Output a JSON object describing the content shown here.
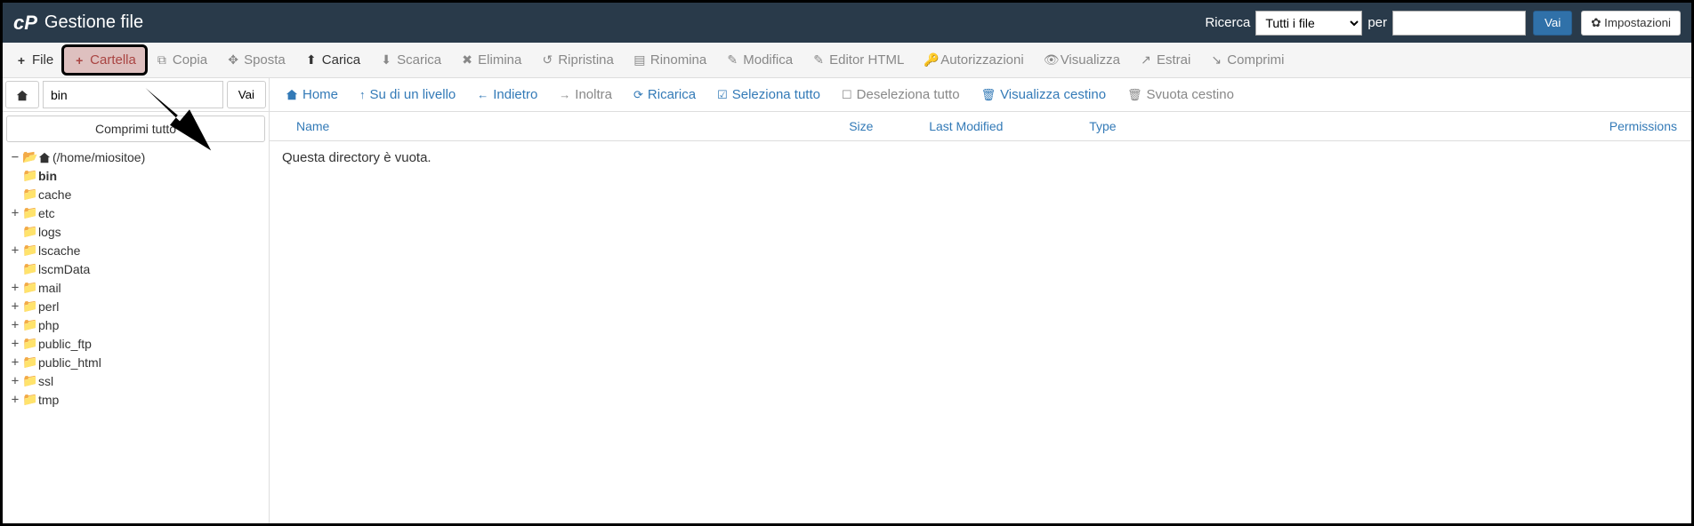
{
  "header": {
    "app_title": "Gestione file",
    "search_label": "Ricerca",
    "scope_selected": "Tutti i file",
    "per_label": "per",
    "search_value": "",
    "go_label": "Vai",
    "settings_label": "Impostazioni"
  },
  "toolbar": {
    "file": "File",
    "cartella": "Cartella",
    "copia": "Copia",
    "sposta": "Sposta",
    "carica": "Carica",
    "scarica": "Scarica",
    "elimina": "Elimina",
    "ripristina": "Ripristina",
    "rinomina": "Rinomina",
    "modifica": "Modifica",
    "editor_html": "Editor HTML",
    "autorizzazioni": "Autorizzazioni",
    "visualizza": "Visualizza",
    "estrai": "Estrai",
    "comprimi": "Comprimi"
  },
  "path_bar": {
    "value": "bin",
    "go": "Vai"
  },
  "nav": {
    "home": "Home",
    "up": "Su di un livello",
    "back": "Indietro",
    "forward": "Inoltra",
    "reload": "Ricarica",
    "select_all": "Seleziona tutto",
    "deselect_all": "Deseleziona tutto",
    "view_trash": "Visualizza cestino",
    "empty_trash": "Svuota cestino"
  },
  "sidebar": {
    "collapse_all": "Comprimi tutto",
    "root_label": "(/home/miositoe)",
    "children": [
      {
        "label": "bin",
        "expandable": false,
        "bold": true
      },
      {
        "label": "cache",
        "expandable": false
      },
      {
        "label": "etc",
        "expandable": true
      },
      {
        "label": "logs",
        "expandable": false
      },
      {
        "label": "lscache",
        "expandable": true
      },
      {
        "label": "lscmData",
        "expandable": false
      },
      {
        "label": "mail",
        "expandable": true
      },
      {
        "label": "perl",
        "expandable": true
      },
      {
        "label": "php",
        "expandable": true
      },
      {
        "label": "public_ftp",
        "expandable": true
      },
      {
        "label": "public_html",
        "expandable": true
      },
      {
        "label": "ssl",
        "expandable": true
      },
      {
        "label": "tmp",
        "expandable": true
      }
    ]
  },
  "table": {
    "columns": {
      "name": "Name",
      "size": "Size",
      "modified": "Last Modified",
      "type": "Type",
      "permissions": "Permissions"
    },
    "empty_message": "Questa directory è vuota."
  }
}
